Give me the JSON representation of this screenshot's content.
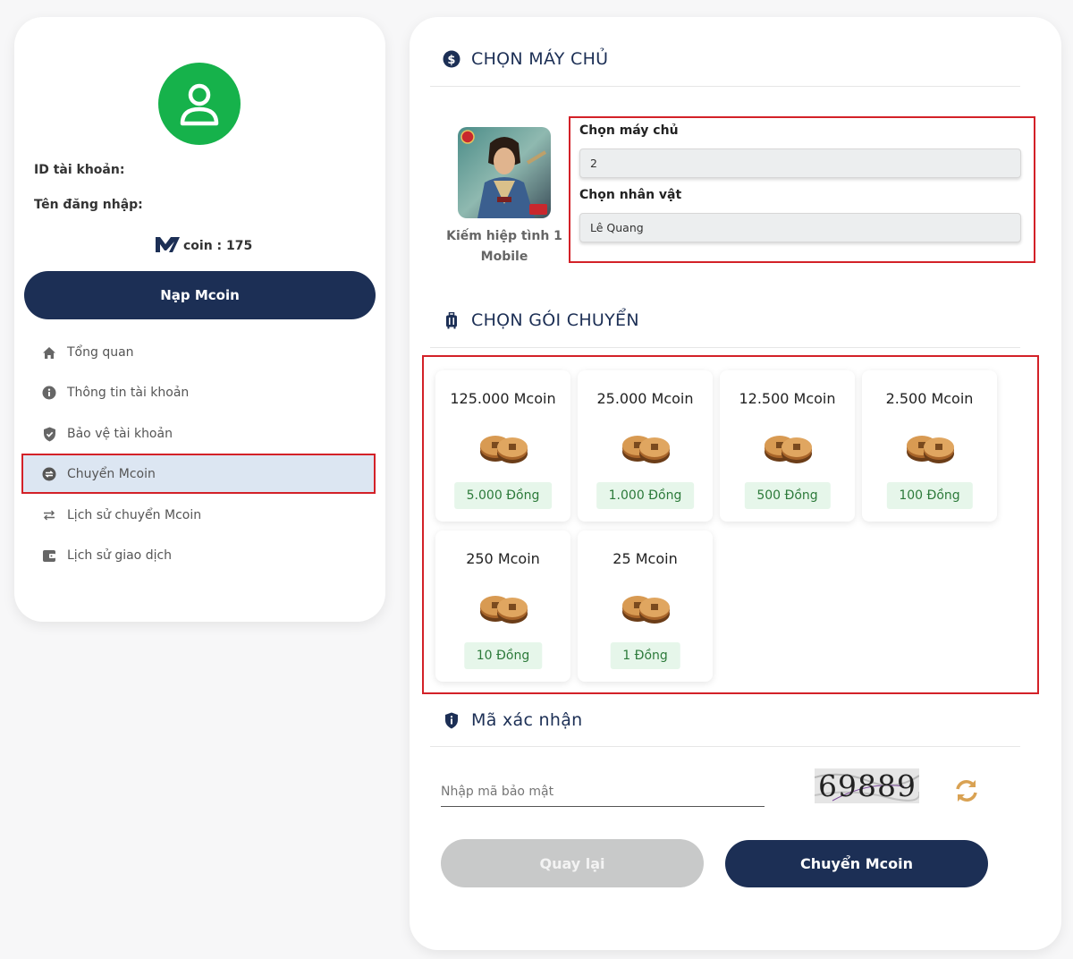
{
  "account": {
    "id_label": "ID tài khoản:",
    "username_label": "Tên đăng nhập:",
    "mcoin_text": "coin : 175",
    "topup_button": "Nạp Mcoin"
  },
  "menu": [
    {
      "label": "Tổng quan",
      "icon": "home-icon"
    },
    {
      "label": "Thông tin tài khoản",
      "icon": "info-icon"
    },
    {
      "label": "Bảo vệ tài khoản",
      "icon": "shield-check-icon"
    },
    {
      "label": "Chuyển Mcoin",
      "icon": "transfer-circle-icon",
      "active": true
    },
    {
      "label": "Lịch sử chuyển Mcoin",
      "icon": "swap-arrows-icon"
    },
    {
      "label": "Lịch sử giao dịch",
      "icon": "wallet-icon"
    }
  ],
  "server_section": {
    "title": "CHỌN MÁY CHỦ",
    "game_name": "Kiếm hiệp tình 1 Mobile",
    "server_label": "Chọn máy chủ",
    "server_value": "2",
    "character_label": "Chọn nhân vật",
    "character_value": "Lê Quang"
  },
  "package_section": {
    "title": "CHỌN GÓI CHUYỂN",
    "packages": [
      {
        "mcoin": "125.000 Mcoin",
        "price": "5.000 Đồng"
      },
      {
        "mcoin": "25.000 Mcoin",
        "price": "1.000 Đồng"
      },
      {
        "mcoin": "12.500 Mcoin",
        "price": "500 Đồng"
      },
      {
        "mcoin": "2.500 Mcoin",
        "price": "100 Đồng"
      },
      {
        "mcoin": "250 Mcoin",
        "price": "10 Đồng"
      },
      {
        "mcoin": "25 Mcoin",
        "price": "1 Đồng"
      }
    ]
  },
  "captcha_section": {
    "title": "Mã xác nhận",
    "input_placeholder": "Nhập mã bảo mật",
    "captcha_code": "69889"
  },
  "actions": {
    "back": "Quay lại",
    "transfer": "Chuyển Mcoin"
  },
  "colors": {
    "navy": "#1c2f55",
    "avatar_green": "#16b24b",
    "highlight_red": "#d32128",
    "price_green": "#2c7a3a",
    "refresh_gold": "#d9a253"
  }
}
